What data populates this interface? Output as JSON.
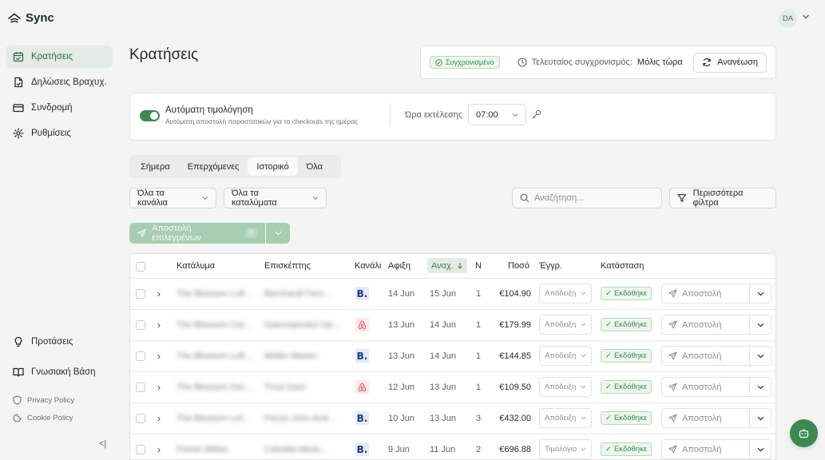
{
  "app": {
    "name": "Sync"
  },
  "sidebar": {
    "items": [
      {
        "label": "Κρατήσεις",
        "icon": "calendar-icon",
        "active": true
      },
      {
        "label": "Δηλώσεις Βραχυχ.",
        "icon": "document-icon",
        "active": false
      },
      {
        "label": "Συνδρομή",
        "icon": "credit-card-icon",
        "active": false
      },
      {
        "label": "Ρυθμίσεις",
        "icon": "gear-icon",
        "active": false
      }
    ],
    "bottom_items": [
      {
        "label": "Προτάσεις",
        "icon": "lightbulb-icon"
      },
      {
        "label": "Γνωσιακή Βάση",
        "icon": "book-icon"
      }
    ],
    "legal": [
      {
        "label": "Privacy Policy",
        "icon": "shield-icon"
      },
      {
        "label": "Cookie Policy",
        "icon": "cookie-icon"
      }
    ],
    "collapse_glyph": "<|"
  },
  "user": {
    "initials": "DA"
  },
  "page": {
    "title": "Κρατήσεις"
  },
  "sync": {
    "badge": "Συγχρονισμένο",
    "last_label": "Τελευταίος συγχρονισμός:",
    "last_value": "Μόλις τώρα",
    "refresh_label": "Ανανέωση"
  },
  "auto_invoice": {
    "enabled": true,
    "title": "Αυτόματη τιμολόγηση",
    "subtitle": "Αυτόματη αποστολή παραστατικών για τα checkouts της ημέρας",
    "time_label": "Ώρα εκτέλεσης",
    "time_value": "07:00"
  },
  "tabs": [
    {
      "label": "Σήμερα",
      "active": false
    },
    {
      "label": "Επερχόμενες",
      "active": false
    },
    {
      "label": "Ιστορικό",
      "active": true
    },
    {
      "label": "Όλα",
      "active": false
    }
  ],
  "filters": {
    "channels": "Όλα τα κανάλια",
    "properties": "Όλα τα καταλύματα",
    "search_placeholder": "Αναζήτηση...",
    "more_filters": "Περισσότερα φίλτρα"
  },
  "bulk": {
    "send_label": "Αποστολή επιλεγμένων",
    "count": "0"
  },
  "table": {
    "headers": {
      "property": "Κατάλυμα",
      "guest": "Επισκέπτης",
      "channel": "Κανάλι",
      "arrival": "Αφιξη",
      "departure": "Αναχ.",
      "nights": "Ν",
      "amount": "Ποσό",
      "document": "Έγγρ.",
      "status": "Κατάσταση"
    },
    "rows": [
      {
        "property": "The Blossom Loft...",
        "guest": "Bernhardt Fern...",
        "channel": "booking",
        "arrival": "14 Jun",
        "departure": "15 Jun",
        "nights": "1",
        "amount": "€104.90",
        "document": "Απόδειξη",
        "status": "Εκδόθηκε",
        "send": "Αποστολή"
      },
      {
        "property": "The Blossom Cot...",
        "guest": "Giannopoulos Ge...",
        "channel": "airbnb",
        "arrival": "13 Jun",
        "departure": "14 Jun",
        "nights": "1",
        "amount": "€179.99",
        "document": "Απόδειξη",
        "status": "Εκδόθηκε",
        "send": "Αποστολή"
      },
      {
        "property": "The Blossom Loft...",
        "guest": "Müller Marion",
        "channel": "booking",
        "arrival": "13 Jun",
        "departure": "14 Jun",
        "nights": "1",
        "amount": "€144.85",
        "document": "Απόδειξη",
        "status": "Εκδόθηκε",
        "send": "Αποστολή"
      },
      {
        "property": "The Blossom Dol...",
        "guest": "Trout Dani",
        "channel": "airbnb",
        "arrival": "12 Jun",
        "departure": "13 Jun",
        "nights": "1",
        "amount": "€109.50",
        "document": "Απόδειξη",
        "status": "Εκδόθηκε",
        "send": "Αποστολή"
      },
      {
        "property": "The Blossom Lof...",
        "guest": "Pezzo John And...",
        "channel": "booking",
        "arrival": "10 Jun",
        "departure": "13 Jun",
        "nights": "3",
        "amount": "€432.00",
        "document": "Απόδειξη",
        "status": "Εκδόθηκε",
        "send": "Αποστολή"
      },
      {
        "property": "Forest Within",
        "guest": "Calzetta Micla...",
        "channel": "booking",
        "arrival": "9 Jun",
        "departure": "11 Jun",
        "nights": "2",
        "amount": "€696.88",
        "document": "Τιμολόγιο",
        "status": "Εκδόθηκε",
        "send": "Αποστολή"
      }
    ]
  },
  "colors": {
    "accent": "#3c8a52",
    "accent_soft": "#e4ebe5",
    "background": "#f4f5f3"
  }
}
